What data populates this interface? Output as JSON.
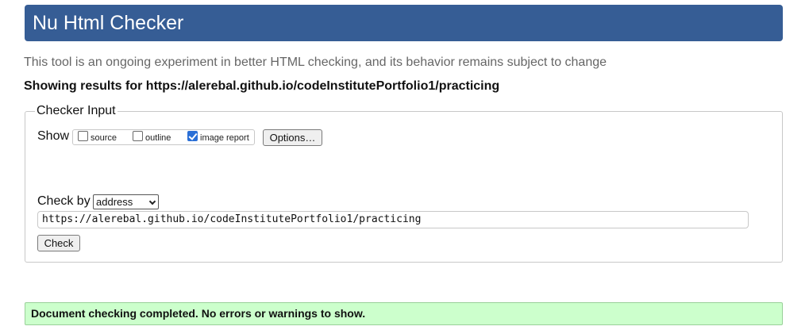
{
  "header": {
    "title": "Nu Html Checker",
    "color": "#365d95"
  },
  "subtitle": "This tool is an ongoing experiment in better HTML checking, and its behavior remains subject to change",
  "results_heading": "Showing results for https://alerebal.github.io/codeInstitutePortfolio1/practicing",
  "checker_input": {
    "legend": "Checker Input",
    "show_label": "Show",
    "show_options": [
      {
        "label": "source",
        "checked": false
      },
      {
        "label": "outline",
        "checked": false
      },
      {
        "label": "image report",
        "checked": true
      }
    ],
    "options_button": "Options…",
    "check_by_label": "Check by",
    "check_by_value": "address",
    "url_value": "https://alerebal.github.io/codeInstitutePortfolio1/practicing",
    "check_button": "Check"
  },
  "status": {
    "message": "Document checking completed. No errors or warnings to show.",
    "color": "#ccffcc"
  }
}
